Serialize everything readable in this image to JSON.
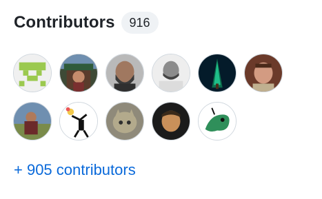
{
  "section": {
    "title": "Contributors",
    "count": "916",
    "more_link": "+ 905 contributors"
  },
  "avatars": [
    {
      "name": "green-identicon-avatar"
    },
    {
      "name": "person-with-trees-avatar"
    },
    {
      "name": "bearded-man-avatar"
    },
    {
      "name": "bald-man-bw-avatar"
    },
    {
      "name": "dark-tree-avatar"
    },
    {
      "name": "smiling-man-avatar"
    },
    {
      "name": "hiker-avatar"
    },
    {
      "name": "flower-thrower-avatar"
    },
    {
      "name": "cat-avatar"
    },
    {
      "name": "man-at-night-avatar"
    },
    {
      "name": "green-cartoon-avatar"
    }
  ],
  "colors": {
    "link": "#0969da",
    "counter_bg": "#eff2f5",
    "text": "#1f2328"
  }
}
